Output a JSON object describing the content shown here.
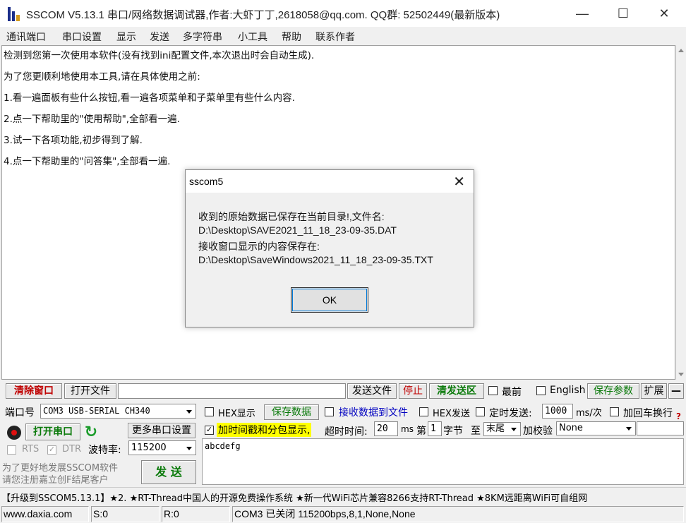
{
  "window": {
    "title": "SSCOM V5.13.1 串口/网络数据调试器,作者:大虾丁丁,2618058@qq.com. QQ群: 52502449(最新版本)",
    "minimize": "—",
    "maximize": "☐",
    "close": "✕"
  },
  "menu": {
    "items": [
      "通讯端口",
      "串口设置",
      "显示",
      "发送",
      "多字符串",
      "小工具",
      "帮助",
      "联系作者"
    ]
  },
  "receive": {
    "lines": [
      "检测到您第一次使用本软件(没有找到ini配置文件,本次退出时会自动生成).",
      "为了您更顺利地使用本工具,请在具体使用之前:",
      "1.看一遍面板有些什么按钮,看一遍各项菜单和子菜单里有些什么内容.",
      "2.点一下帮助里的\"使用帮助\",全部看一遍.",
      "3.试一下各项功能,初步得到了解.",
      "4.点一下帮助里的\"问答集\",全部看一遍."
    ]
  },
  "dialog": {
    "title": "sscom5",
    "close": "✕",
    "lines": [
      "收到的原始数据已保存在当前目录!,文件名:",
      "D:\\Desktop\\SAVE2021_11_18_23-09-35.DAT",
      "接收窗口显示的内容保存在:",
      "D:\\Desktop\\SaveWindows2021_11_18_23-09-35.TXT"
    ],
    "ok_label": "OK"
  },
  "toolbar1": {
    "clear_label": "清除窗口",
    "open_file_label": "打开文件",
    "file_path_value": "",
    "send_file_label": "发送文件",
    "stop_label": "停止",
    "clear_send_label": "清发送区",
    "topmost_label": "最前",
    "english_label": "English",
    "save_params_label": "保存参数",
    "expand_label": "扩展",
    "collapse_label": "—"
  },
  "port": {
    "port_label": "端口号",
    "port_value": "COM3 USB-SERIAL CH340",
    "hex_display_label": "HEX显示",
    "save_data_label": "保存数据",
    "recv_to_file_label": "接收数据到文件",
    "hex_send_label": "HEX发送",
    "timed_send_label": "定时发送:",
    "interval_value": "1000",
    "interval_unit": "ms/次",
    "add_crlf_label": "加回车换行",
    "open_port_label": "打开串口",
    "more_settings_label": "更多串口设置",
    "timestamp_label": "加时间戳和分包显示,",
    "timeout_label": "超时时间:",
    "timeout_value": "20",
    "timeout_unit": "ms",
    "byte_prefix": "第",
    "byte_value": "1",
    "byte_suffix": "字节",
    "to_label": "至",
    "end_value": "末尾",
    "checksum_label": "加校验",
    "checksum_value": "None",
    "rts_label": "RTS",
    "dtr_label": "DTR",
    "baud_label": "波特率:",
    "baud_value": "115200",
    "help_icon": "?"
  },
  "promo": {
    "line1": "为了更好地发展SSCOM软件",
    "line2": "请您注册嘉立创F结尾客户"
  },
  "send": {
    "button_label": "发 送",
    "text": "abcdefg"
  },
  "marquee": {
    "text": "【升级到SSCOM5.13.1】★2. ★RT-Thread中国人的开源免费操作系统 ★新一代WiFi芯片兼容8266支持RT-Thread ★8KM远距离WiFi可自组网"
  },
  "status": {
    "website": "www.daxia.com",
    "sent": "S:0",
    "received": "R:0",
    "port_status": "COM3 已关闭  115200bps,8,1,None,None"
  },
  "colors": {
    "red_text": "#c00000",
    "green_text": "#0a7a0a",
    "blue_text": "#0000c0",
    "highlight_yellow": "#ffff00"
  }
}
